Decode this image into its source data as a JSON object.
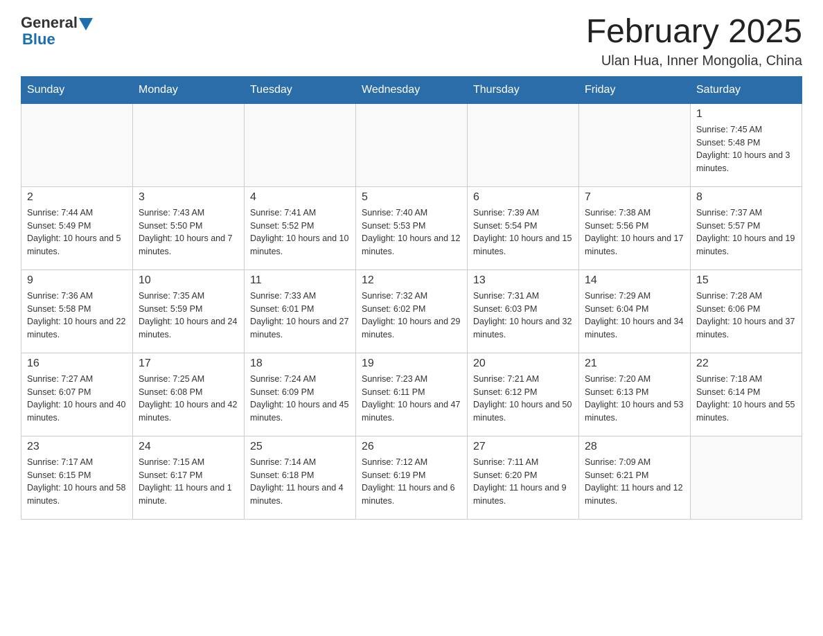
{
  "header": {
    "logo_general": "General",
    "logo_blue": "Blue",
    "title": "February 2025",
    "subtitle": "Ulan Hua, Inner Mongolia, China"
  },
  "days_of_week": [
    "Sunday",
    "Monday",
    "Tuesday",
    "Wednesday",
    "Thursday",
    "Friday",
    "Saturday"
  ],
  "weeks": [
    [
      {
        "day": "",
        "info": ""
      },
      {
        "day": "",
        "info": ""
      },
      {
        "day": "",
        "info": ""
      },
      {
        "day": "",
        "info": ""
      },
      {
        "day": "",
        "info": ""
      },
      {
        "day": "",
        "info": ""
      },
      {
        "day": "1",
        "info": "Sunrise: 7:45 AM\nSunset: 5:48 PM\nDaylight: 10 hours and 3 minutes."
      }
    ],
    [
      {
        "day": "2",
        "info": "Sunrise: 7:44 AM\nSunset: 5:49 PM\nDaylight: 10 hours and 5 minutes."
      },
      {
        "day": "3",
        "info": "Sunrise: 7:43 AM\nSunset: 5:50 PM\nDaylight: 10 hours and 7 minutes."
      },
      {
        "day": "4",
        "info": "Sunrise: 7:41 AM\nSunset: 5:52 PM\nDaylight: 10 hours and 10 minutes."
      },
      {
        "day": "5",
        "info": "Sunrise: 7:40 AM\nSunset: 5:53 PM\nDaylight: 10 hours and 12 minutes."
      },
      {
        "day": "6",
        "info": "Sunrise: 7:39 AM\nSunset: 5:54 PM\nDaylight: 10 hours and 15 minutes."
      },
      {
        "day": "7",
        "info": "Sunrise: 7:38 AM\nSunset: 5:56 PM\nDaylight: 10 hours and 17 minutes."
      },
      {
        "day": "8",
        "info": "Sunrise: 7:37 AM\nSunset: 5:57 PM\nDaylight: 10 hours and 19 minutes."
      }
    ],
    [
      {
        "day": "9",
        "info": "Sunrise: 7:36 AM\nSunset: 5:58 PM\nDaylight: 10 hours and 22 minutes."
      },
      {
        "day": "10",
        "info": "Sunrise: 7:35 AM\nSunset: 5:59 PM\nDaylight: 10 hours and 24 minutes."
      },
      {
        "day": "11",
        "info": "Sunrise: 7:33 AM\nSunset: 6:01 PM\nDaylight: 10 hours and 27 minutes."
      },
      {
        "day": "12",
        "info": "Sunrise: 7:32 AM\nSunset: 6:02 PM\nDaylight: 10 hours and 29 minutes."
      },
      {
        "day": "13",
        "info": "Sunrise: 7:31 AM\nSunset: 6:03 PM\nDaylight: 10 hours and 32 minutes."
      },
      {
        "day": "14",
        "info": "Sunrise: 7:29 AM\nSunset: 6:04 PM\nDaylight: 10 hours and 34 minutes."
      },
      {
        "day": "15",
        "info": "Sunrise: 7:28 AM\nSunset: 6:06 PM\nDaylight: 10 hours and 37 minutes."
      }
    ],
    [
      {
        "day": "16",
        "info": "Sunrise: 7:27 AM\nSunset: 6:07 PM\nDaylight: 10 hours and 40 minutes."
      },
      {
        "day": "17",
        "info": "Sunrise: 7:25 AM\nSunset: 6:08 PM\nDaylight: 10 hours and 42 minutes."
      },
      {
        "day": "18",
        "info": "Sunrise: 7:24 AM\nSunset: 6:09 PM\nDaylight: 10 hours and 45 minutes."
      },
      {
        "day": "19",
        "info": "Sunrise: 7:23 AM\nSunset: 6:11 PM\nDaylight: 10 hours and 47 minutes."
      },
      {
        "day": "20",
        "info": "Sunrise: 7:21 AM\nSunset: 6:12 PM\nDaylight: 10 hours and 50 minutes."
      },
      {
        "day": "21",
        "info": "Sunrise: 7:20 AM\nSunset: 6:13 PM\nDaylight: 10 hours and 53 minutes."
      },
      {
        "day": "22",
        "info": "Sunrise: 7:18 AM\nSunset: 6:14 PM\nDaylight: 10 hours and 55 minutes."
      }
    ],
    [
      {
        "day": "23",
        "info": "Sunrise: 7:17 AM\nSunset: 6:15 PM\nDaylight: 10 hours and 58 minutes."
      },
      {
        "day": "24",
        "info": "Sunrise: 7:15 AM\nSunset: 6:17 PM\nDaylight: 11 hours and 1 minute."
      },
      {
        "day": "25",
        "info": "Sunrise: 7:14 AM\nSunset: 6:18 PM\nDaylight: 11 hours and 4 minutes."
      },
      {
        "day": "26",
        "info": "Sunrise: 7:12 AM\nSunset: 6:19 PM\nDaylight: 11 hours and 6 minutes."
      },
      {
        "day": "27",
        "info": "Sunrise: 7:11 AM\nSunset: 6:20 PM\nDaylight: 11 hours and 9 minutes."
      },
      {
        "day": "28",
        "info": "Sunrise: 7:09 AM\nSunset: 6:21 PM\nDaylight: 11 hours and 12 minutes."
      },
      {
        "day": "",
        "info": ""
      }
    ]
  ]
}
